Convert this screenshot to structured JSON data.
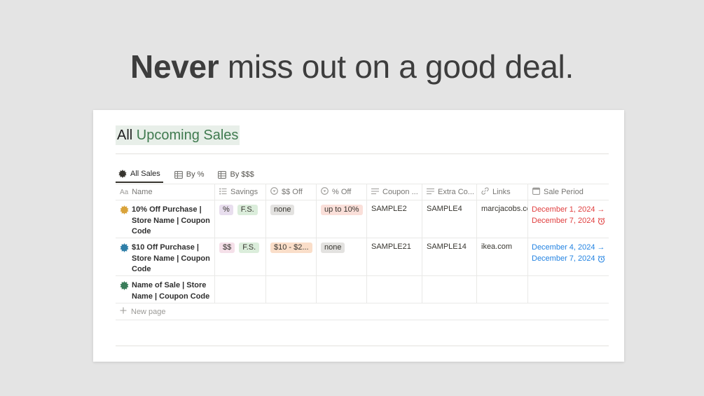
{
  "headline": {
    "bold": "Never",
    "rest": "miss out on a good deal."
  },
  "database": {
    "title_part1": "All",
    "title_part2": "Upcoming Sales",
    "tabs": [
      {
        "label": "All Sales",
        "icon": "burst-icon",
        "active": true
      },
      {
        "label": "By %",
        "icon": "table-icon",
        "active": false
      },
      {
        "label": "By $$$",
        "icon": "table-icon",
        "active": false
      }
    ],
    "columns": [
      {
        "label": "Name",
        "icon": "text-aa-icon"
      },
      {
        "label": "Savings",
        "icon": "list-icon"
      },
      {
        "label": "$$ Off",
        "icon": "select-icon"
      },
      {
        "label": "% Off",
        "icon": "select-icon"
      },
      {
        "label": "Coupon ...",
        "icon": "lines-icon"
      },
      {
        "label": "Extra Co...",
        "icon": "lines-icon"
      },
      {
        "label": "Links",
        "icon": "link-icon"
      },
      {
        "label": "Sale Period",
        "icon": "calendar-icon"
      }
    ],
    "rows": [
      {
        "name": "10% Off Purchase | Store Name | Coupon Code",
        "badge_color": "#d9a33a",
        "savings": [
          "%",
          "F.S."
        ],
        "dollar_off": "none",
        "pct_off": "up to 10%",
        "coupon": "SAMPLE2",
        "extra": "SAMPLE4",
        "link": "marcjacobs.com",
        "period_start": "December 1, 2024 →",
        "period_end": "December 7, 2024",
        "period_color": "#e03e3e"
      },
      {
        "name": "$10 Off Purchase | Store Name | Coupon Code",
        "badge_color": "#2f7fa8",
        "savings": [
          "$$",
          "F.S."
        ],
        "dollar_off": "$10 - $2...",
        "pct_off": "none",
        "coupon": "SAMPLE21",
        "extra": "SAMPLE14",
        "link": "ikea.com",
        "period_start": "December 4, 2024 →",
        "period_end": "December 7, 2024",
        "period_color": "#2383e2"
      },
      {
        "name": "Name of Sale | Store Name | Coupon Code",
        "badge_color": "#3a7d5a"
      }
    ],
    "new_page_label": "New page"
  }
}
